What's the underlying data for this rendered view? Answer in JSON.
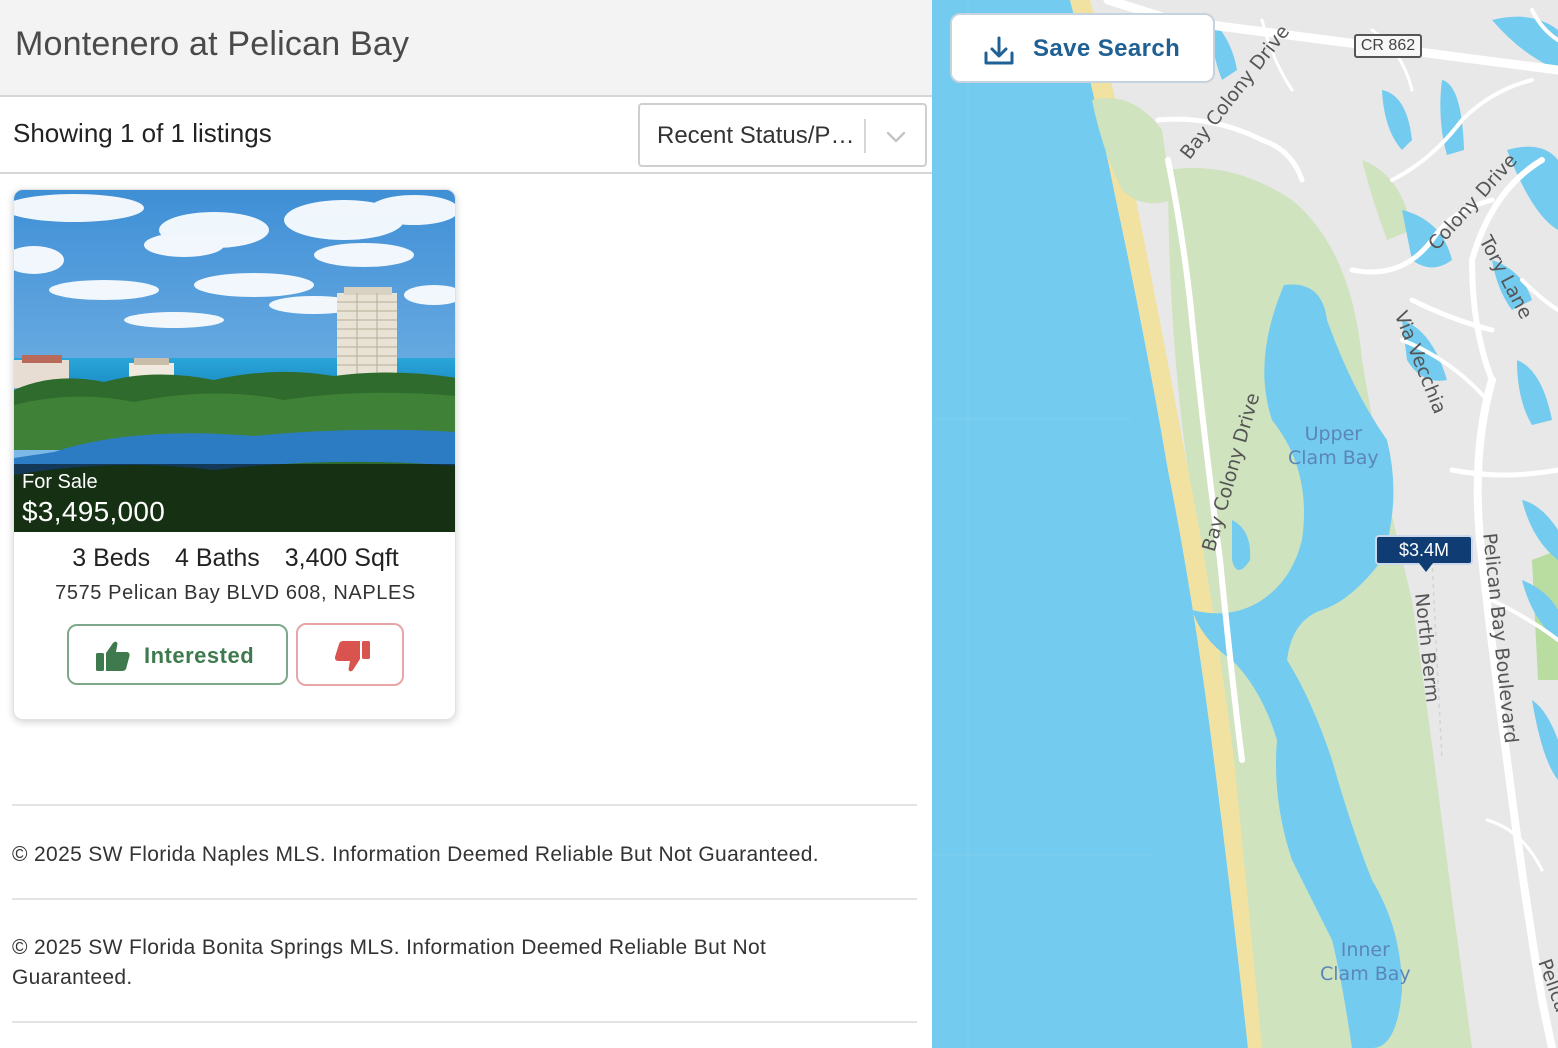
{
  "page": {
    "title": "Montenero at Pelican Bay"
  },
  "toolbar": {
    "listing_count": "Showing 1 of 1 listings",
    "sort_value": "Recent Status/Price"
  },
  "listing": {
    "status": "For Sale",
    "price": "$3,495,000",
    "beds": "3 Beds",
    "baths": "4 Baths",
    "sqft": "3,400 Sqft",
    "address": "7575 Pelican Bay BLVD 608, NAPLES",
    "interested_label": "Interested"
  },
  "disclaimers": [
    "© 2025 SW Florida Naples MLS. Information Deemed Reliable But Not Guaranteed.",
    "© 2025 SW Florida Bonita Springs MLS. Information Deemed Reliable But Not Guaranteed."
  ],
  "map": {
    "save_search_label": "Save Search",
    "road_shield": "CR 862",
    "price_pin": "$3.4M",
    "labels": {
      "bay_colony_top": "Bay Colony Drive",
      "bay_colony_side": "Bay Colony Drive",
      "colony_drive": "Colony Drive",
      "tory_lane": "Tory Lane",
      "via_vecchia": "Via Vecchia",
      "upper_clam_bay": "Upper\nClam Bay",
      "inner_clam_bay": "Inner\nClam Bay",
      "north_berm": "North Berm",
      "pelican_bay_blvd": "Pelican Bay Boulevard",
      "pelican_edge": "Pelica"
    },
    "colors": {
      "water": "#73cbef",
      "land": "#e8e8e8",
      "park": "#cfe3bf",
      "beach": "#f1e2a2",
      "road": "#ffffff",
      "pin": "#0f3d73"
    }
  },
  "icons": {
    "sort_chevron": "chevron-down-icon",
    "thumb_up": "thumbs-up-icon",
    "thumb_down": "thumbs-down-icon",
    "download": "download-icon"
  },
  "colors": {
    "interested_green": "#3f7a4e",
    "dislike_red": "#d9534f",
    "save_search_blue": "#1f6194"
  }
}
